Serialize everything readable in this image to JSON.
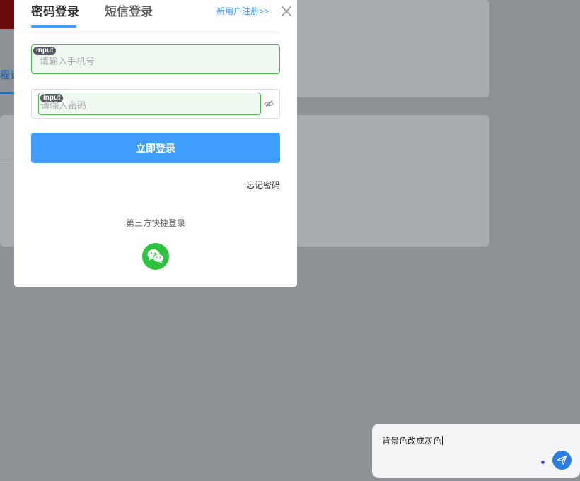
{
  "background": {
    "tab_fragment": "程记"
  },
  "login": {
    "tabs": [
      {
        "label": "密码登录",
        "active": true
      },
      {
        "label": "短信登录",
        "active": false
      }
    ],
    "register_link": "新用户注册>>",
    "phone_placeholder": "请输入手机号",
    "password_placeholder": "请输入密码",
    "input_tag": "input",
    "submit_label": "立即登录",
    "forgot_label": "忘记密码",
    "third_party_label": "第三方快捷登录",
    "accent_color": "#409eff",
    "wechat_color": "#2dc13f"
  },
  "chat": {
    "input_value": "背景色改成灰色"
  },
  "icons": {
    "close": "close-icon",
    "eye": "eye-off-icon",
    "wechat": "wechat-icon",
    "send": "send-icon"
  }
}
